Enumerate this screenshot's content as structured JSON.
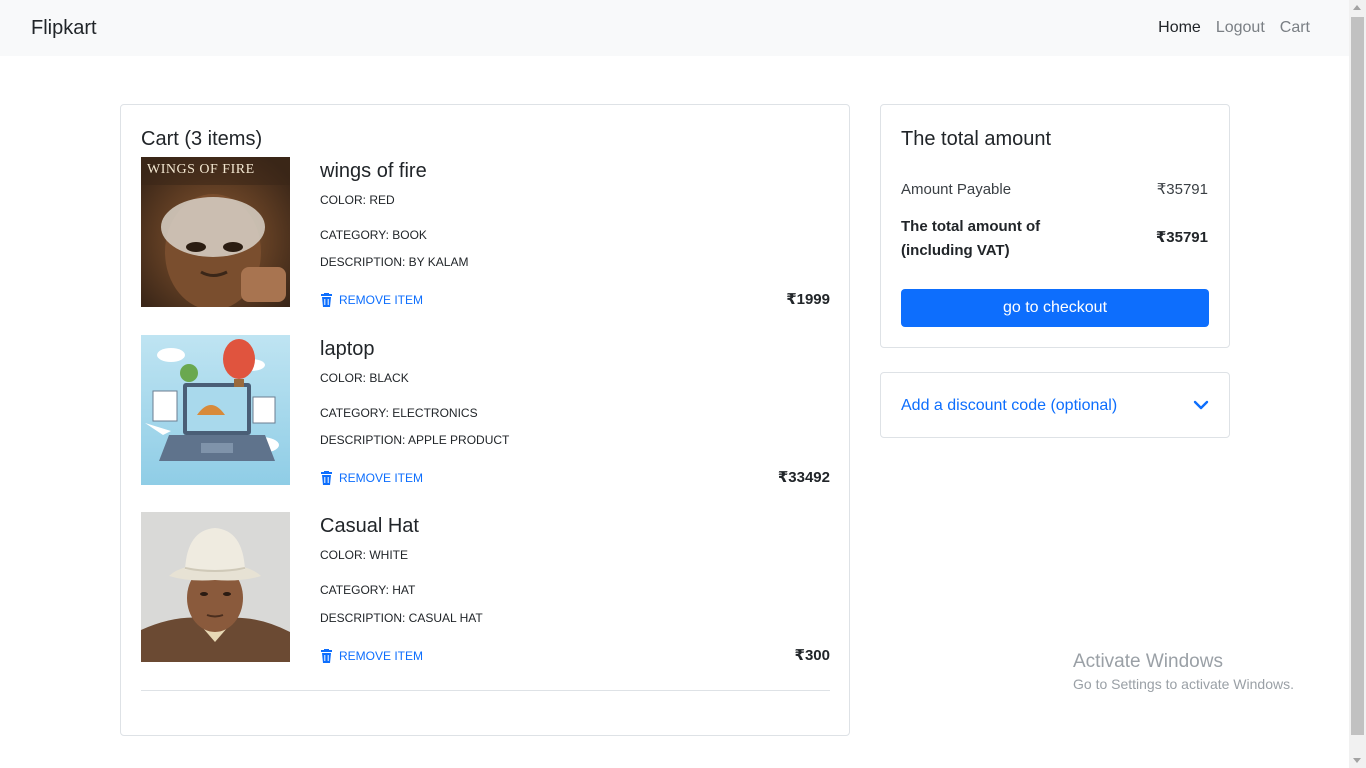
{
  "navbar": {
    "brand": "Flipkart",
    "links": [
      {
        "label": "Home",
        "active": true
      },
      {
        "label": "Logout",
        "active": false
      },
      {
        "label": "Cart",
        "active": false
      }
    ]
  },
  "cart": {
    "title": "Cart (3 items)",
    "remove_label": "REMOVE ITEM",
    "items": [
      {
        "name": "wings of fire",
        "color": "COLOR: RED",
        "category": "CATEGORY: BOOK",
        "description": "DESCRIPTION: BY KALAM",
        "price": "₹1999",
        "image_cover_text": "WINGS OF FIRE"
      },
      {
        "name": "laptop",
        "color": "COLOR: BLACK",
        "category": "CATEGORY: ELECTRONICS",
        "description": "DESCRIPTION: APPLE PRODUCT",
        "price": "₹33492"
      },
      {
        "name": "Casual Hat",
        "color": "COLOR: WHITE",
        "category": "CATEGORY: HAT",
        "description": "DESCRIPTION: CASUAL HAT",
        "price": "₹300"
      }
    ]
  },
  "summary": {
    "title": "The total amount",
    "amount_payable_label": "Amount Payable",
    "amount_payable_value": "₹35791",
    "total_label": "The total amount of (including VAT)",
    "total_value": "₹35791",
    "checkout_label": "go to checkout"
  },
  "discount": {
    "label": "Add a discount code (optional)"
  },
  "watermark": {
    "line1": "Activate Windows",
    "line2": "Go to Settings to activate Windows."
  },
  "colors": {
    "accent": "#0d6efd",
    "navbar_bg": "#f8f9fa",
    "border": "#dee2e6"
  },
  "icons": [
    "trash-icon",
    "chevron-down-icon"
  ]
}
